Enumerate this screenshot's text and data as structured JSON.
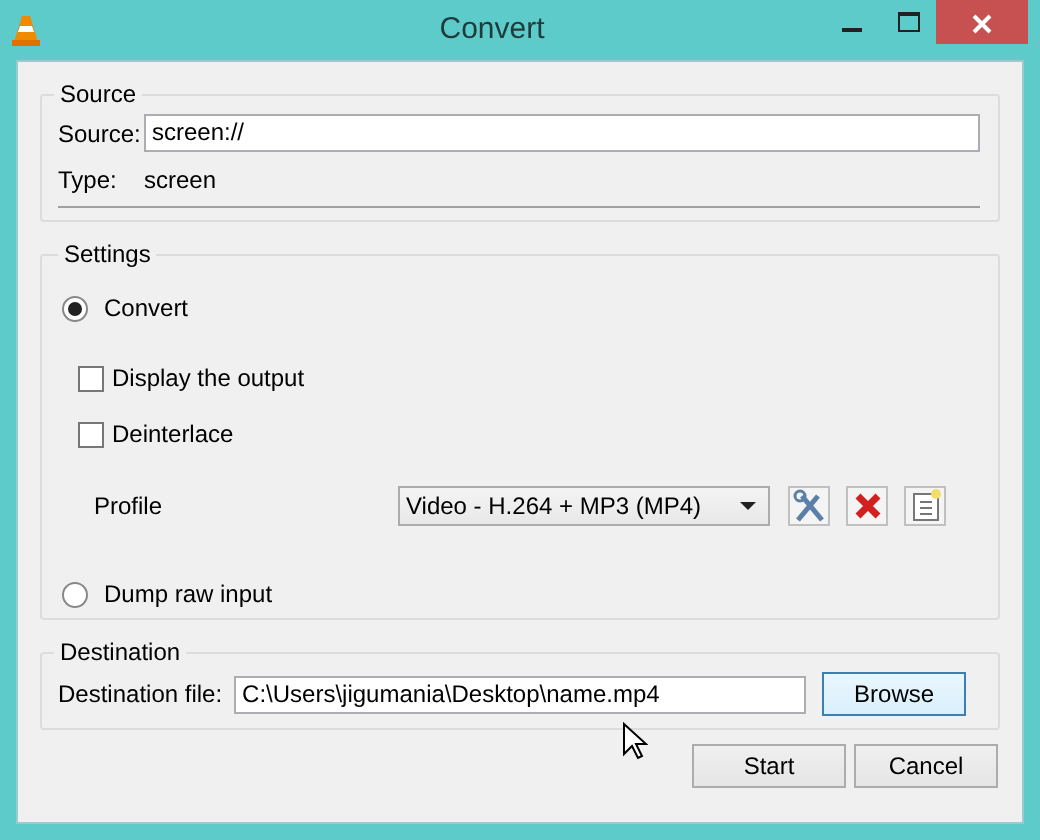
{
  "window": {
    "title": "Convert"
  },
  "source": {
    "group": "Source",
    "source_label": "Source:",
    "source_value": "screen://",
    "type_label": "Type:",
    "type_value": "screen"
  },
  "settings": {
    "group": "Settings",
    "modes": [
      {
        "label": "Convert",
        "selected": true
      },
      {
        "label": "Dump raw input",
        "selected": false
      }
    ],
    "options": [
      {
        "label": "Display the output",
        "checked": false
      },
      {
        "label": "Deinterlace",
        "checked": false
      }
    ],
    "profile_label": "Profile",
    "profile_value": "Video - H.264 + MP3 (MP4)"
  },
  "destination": {
    "group": "Destination",
    "label": "Destination file:",
    "value": "C:\\Users\\jigumania\\Desktop\\name.mp4",
    "browse": "Browse"
  },
  "buttons": [
    "Start",
    "Cancel"
  ]
}
